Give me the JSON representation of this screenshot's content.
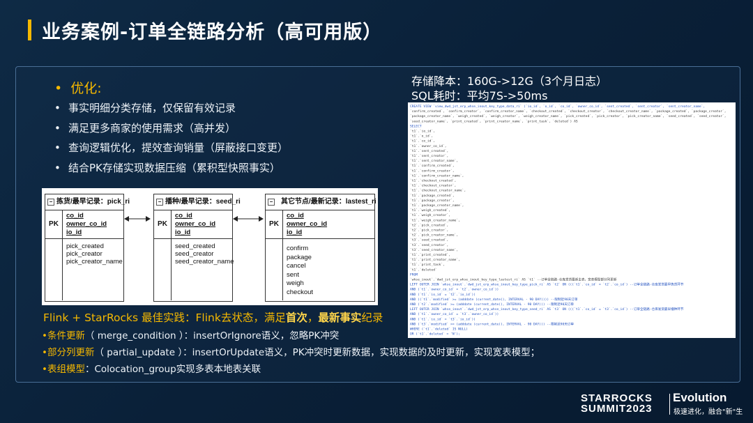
{
  "slide": {
    "title": "业务案例-订单全链路分析（高可用版）",
    "accent_color": "#f5b800"
  },
  "optimization": {
    "heading": "优化:",
    "bullet_glyph": "•",
    "items": [
      "事实明细分类存储，仅保留有效记录",
      "满足更多商家的使用需求（高并发）",
      "查询逻辑优化，提效查询销量（屏蔽接口变更）",
      "结合PK存储实现数据压缩（累积型快照事实）"
    ]
  },
  "stats": {
    "storage": "存储降本：160G->12G（3个月日志）",
    "sql_time": "SQL耗时：平均7S->50ms"
  },
  "diagram": {
    "tables": [
      {
        "title": "拣货/最早记录：pick_ri",
        "pk_label": "PK",
        "pk_fields": [
          "co_id",
          "owner_co_id",
          "io_id"
        ],
        "fields": [
          "pick_created",
          "pick_creator",
          "pick_creator_name"
        ]
      },
      {
        "title": "播种/最早记录：seed_ri",
        "pk_label": "PK",
        "pk_fields": [
          "co_id",
          "owner_co_id",
          "io_id"
        ],
        "fields": [
          "seed_created",
          "seed_creator",
          "seed_creator_name"
        ]
      },
      {
        "title": "其它节点/最新记录：lastest_ri",
        "pk_label": "PK",
        "pk_fields": [
          "co_id",
          "owner_co_id",
          "io_id"
        ],
        "fields": [
          "confirm",
          "package",
          "cancel",
          "sent",
          "weigh",
          "checkout"
        ]
      }
    ]
  },
  "flink": {
    "heading_prefix": "Flink + StarRocks 最佳实践：Flink去状态，满足",
    "heading_em1": "首次",
    "heading_sep": "，",
    "heading_em2": "最新事实",
    "heading_suffix": "纪录",
    "lines": [
      {
        "key": "•条件更新",
        "text": "（ merge_condition ）：insertOrIgnore语义，忽略PK冲突"
      },
      {
        "key": "•部分列更新",
        "text": "（ partial_update ）：insertOrUpdate语义，PK冲突时更新数据，实现数据的及时更新，实现宽表模型；"
      },
      {
        "key": "•表组模型",
        "text": "：Colocation_group实现多表本地表关联"
      }
    ]
  },
  "code": {
    "lines": [
      "CREATE VIEW `view_dwd_jst_erp_whse_inout_key_type_data_ri` (`io_id`, `o_id`, `co_id`, `owner_co_id`, `sent_created`, `sent_creator`, `sent_creator_name`,",
      "`confirm_created`, `confirm_creator`, `confirm_creator_name`, `checkout_created`, `checkout_creator`, `checkout_creator_name`, `package_created`, `package_creator`,",
      "`package_creator_name`, `weigh_created`, `weigh_creator`, `weigh_creator_name`, `pick_created`, `pick_creator`, `pick_creator_name`, `seed_created`, `seed_creator`,",
      "`seed_creator_name`, `print_created`, `print_creator_name`, `print_task`, `deleted`) AS",
      "SELECT",
      "  `t1`.`io_id`,",
      "  `t1`.`o_id`,",
      "  `t1`.`co_id`,",
      "  `t1`.`owner_co_id`,",
      "  `t1`.`sent_created`,",
      "  `t1`.`sent_creator`,",
      "  `t1`.`sent_creator_name`,",
      "  `t1`.`confirm_created`,",
      "  `t1`.`confirm_creator`,",
      "  `t1`.`confirm_creator_name`,",
      "  `t1`.`checkout_created`,",
      "  `t1`.`checkout_creator`,",
      "  `t1`.`checkout_creator_name`,",
      "  `t1`.`package_created`,",
      "  `t1`.`package_creator`,",
      "  `t1`.`package_creator_name`,",
      "  `t1`.`weigh_created`,",
      "  `t1`.`weigh_creator`,",
      "  `t1`.`weigh_creator_name`,",
      "  `t2`.`pick_created`,",
      "  `t2`.`pick_creator`,",
      "  `t2`.`pick_creator_name`,",
      "  `t3`.`seed_created`,",
      "  `t3`.`seed_creator`,",
      "  `t3`.`seed_creator_name`,",
      "  `t1`.`print_created`,",
      "  `t1`.`print_creator_name`,",
      "  `t1`.`print_task`,",
      "  `t1`.`deleted`",
      "FROM",
      "  `whse_inout`.`dwd_jst_erp_whse_inout_key_type_lastest_ri` AS `t1` --订单全链路-仓库发货最新主表，宽表模型部分列更新",
      "  LEFT OUTER JOIN `whse_inout`.`dwd_jst_erp_whse_inout_key_type_pick_ri` AS `t2` ON (((`t1`.`co_id` = `t2`.`co_id`) --订单全链路-仓库发货最早拣货环节",
      "           AND (`t1`.`owner_co_id` = `t2`.`owner_co_id`))",
      "       AND (`t1`.`io_id` = `t2`.`io_id`))",
      "    AND ((`t1`.`modified` >= (adddate (current_date(), INTERVAL - 90 DAY)))) --限制近90天订单",
      "  AND (`t2`.`modified` >= (adddate (current_date(), INTERVAL - 90 DAY))) --限制近90天订单",
      "  LEFT OUTER JOIN `whse_inout`.`dwd_jst_erp_whse_inout_key_type_seed_ri` AS `t3` ON (((`t1`.`co_id` = `t3`.`co_id`) --订单全链路-仓库发货最早播种环节",
      "       AND (`t1`.`owner_co_id` = `t3`.`owner_co_id`))",
      "     AND (`t1`.`io_id` = `t3`.`io_id`))",
      "  AND (`t3`.`modified` >= (adddate (current_date(), INTERVAL - 90 DAY))) --限制近90天订单",
      "WHERE (`t1`.`deleted` IS NULL)",
      "  OR (`t1`.`deleted` = 'N');"
    ]
  },
  "branding": {
    "line1": "STARROCKS",
    "line2": "SUMMIT2023",
    "product": "Evolution",
    "tagline": "极速进化，融合\"新\"生"
  }
}
